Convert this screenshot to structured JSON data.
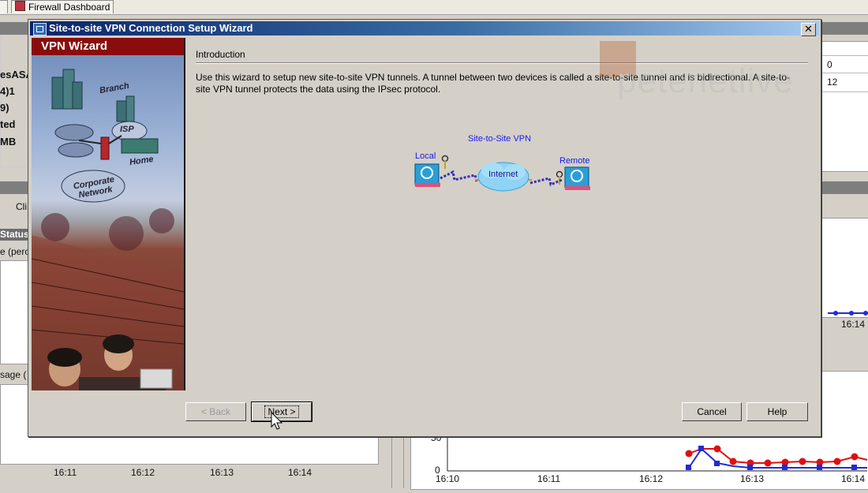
{
  "background": {
    "tabs": [
      "Firewall Dashboard"
    ],
    "left_fragments": [
      "esASA",
      "4)1",
      "9)",
      "ted",
      "MB"
    ],
    "cli_fragment": "Cli",
    "status_header": "Status",
    "status_sub": "e (perc",
    "usage_fragment": "sage (",
    "right_values": [
      "0",
      "12"
    ],
    "chart_left_ticks": [
      "16:11",
      "16:12",
      "16:13",
      "16:14"
    ],
    "chart_right_ticks": [
      "16:10",
      "16:11",
      "16:12",
      "16:13",
      "16:14"
    ],
    "chart_right_y": [
      "50",
      "0"
    ],
    "upper_right_tick": "16:14",
    "series_colors": {
      "red": "#dd1111",
      "blue": "#1f2bd6"
    }
  },
  "dialog": {
    "title": "Site-to-site VPN Connection Setup Wizard",
    "close_label": "✕",
    "side_header": "VPN Wizard",
    "side_labels": {
      "branch": "Branch",
      "isp": "ISP",
      "home": "Home",
      "corporate": "Corporate Network"
    },
    "section_title": "Introduction",
    "intro_text": "Use this wizard to setup new site-to-site VPN tunnels. A tunnel between two devices is called a site-to-site tunnel and is bidirectional. A site-to-site VPN tunnel protects the data using the IPsec protocol.",
    "diagram": {
      "title": "Site-to-Site VPN",
      "local": "Local",
      "remote": "Remote",
      "internet": "Internet"
    },
    "buttons": {
      "back": "< Back",
      "next": "Next >",
      "cancel": "Cancel",
      "help": "Help"
    }
  },
  "watermark": {
    "text": "petenetlive"
  }
}
